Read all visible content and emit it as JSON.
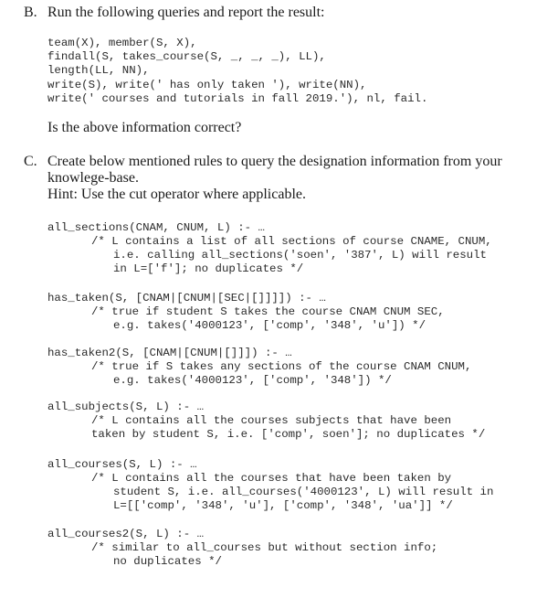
{
  "section_b": {
    "marker": "B.",
    "heading": "Run the following queries and report the result:",
    "code": [
      "team(X), member(S, X),",
      "findall(S, takes_course(S, _, _, _), LL),",
      "length(LL, NN),",
      "write(S), write(' has only taken '), write(NN),",
      "write(' courses and tutorials in fall 2019.'), nl, fail."
    ],
    "question": "Is the above information correct?"
  },
  "section_c": {
    "marker": "C.",
    "heading_line1": "Create below mentioned rules to query the designation information from your",
    "heading_line2": "knowlege-base.",
    "hint": "Hint: Use the cut operator where applicable.",
    "rules": [
      {
        "signature": "all_sections(CNAM, CNUM, L) :- …",
        "comment": [
          "/* L contains a list of all sections of course CNAME, CNUM,",
          "i.e. calling all_sections('soen', '387', L) will result",
          "in L=['f']; no duplicates */"
        ]
      },
      {
        "signature": "has_taken(S, [CNAM|[CNUM|[SEC|[]]]]) :- …",
        "comment": [
          "/* true if student S takes the course CNAM CNUM SEC,",
          "e.g. takes('4000123', ['comp', '348', 'u']) */"
        ]
      },
      {
        "signature": "has_taken2(S, [CNAM|[CNUM|[]]]) :- …",
        "comment": [
          "/* true if S takes any sections of the course CNAM CNUM,",
          "e.g. takes('4000123', ['comp', '348']) */"
        ]
      },
      {
        "signature": "all_subjects(S, L) :- …",
        "comment": [
          "/* L contains all the courses subjects that have been",
          "taken by student S, i.e. ['comp', soen']; no duplicates */"
        ]
      },
      {
        "signature": "all_courses(S, L) :- …",
        "comment": [
          "/* L contains all the courses that have been taken by",
          "student S, i.e. all_courses('4000123', L) will result in",
          "L=[['comp', '348', 'u'], ['comp', '348', 'ua']] */"
        ]
      },
      {
        "signature": "all_courses2(S, L) :- …",
        "comment": [
          "/* similar to all_courses but without section info;",
          "no duplicates */"
        ]
      }
    ]
  }
}
